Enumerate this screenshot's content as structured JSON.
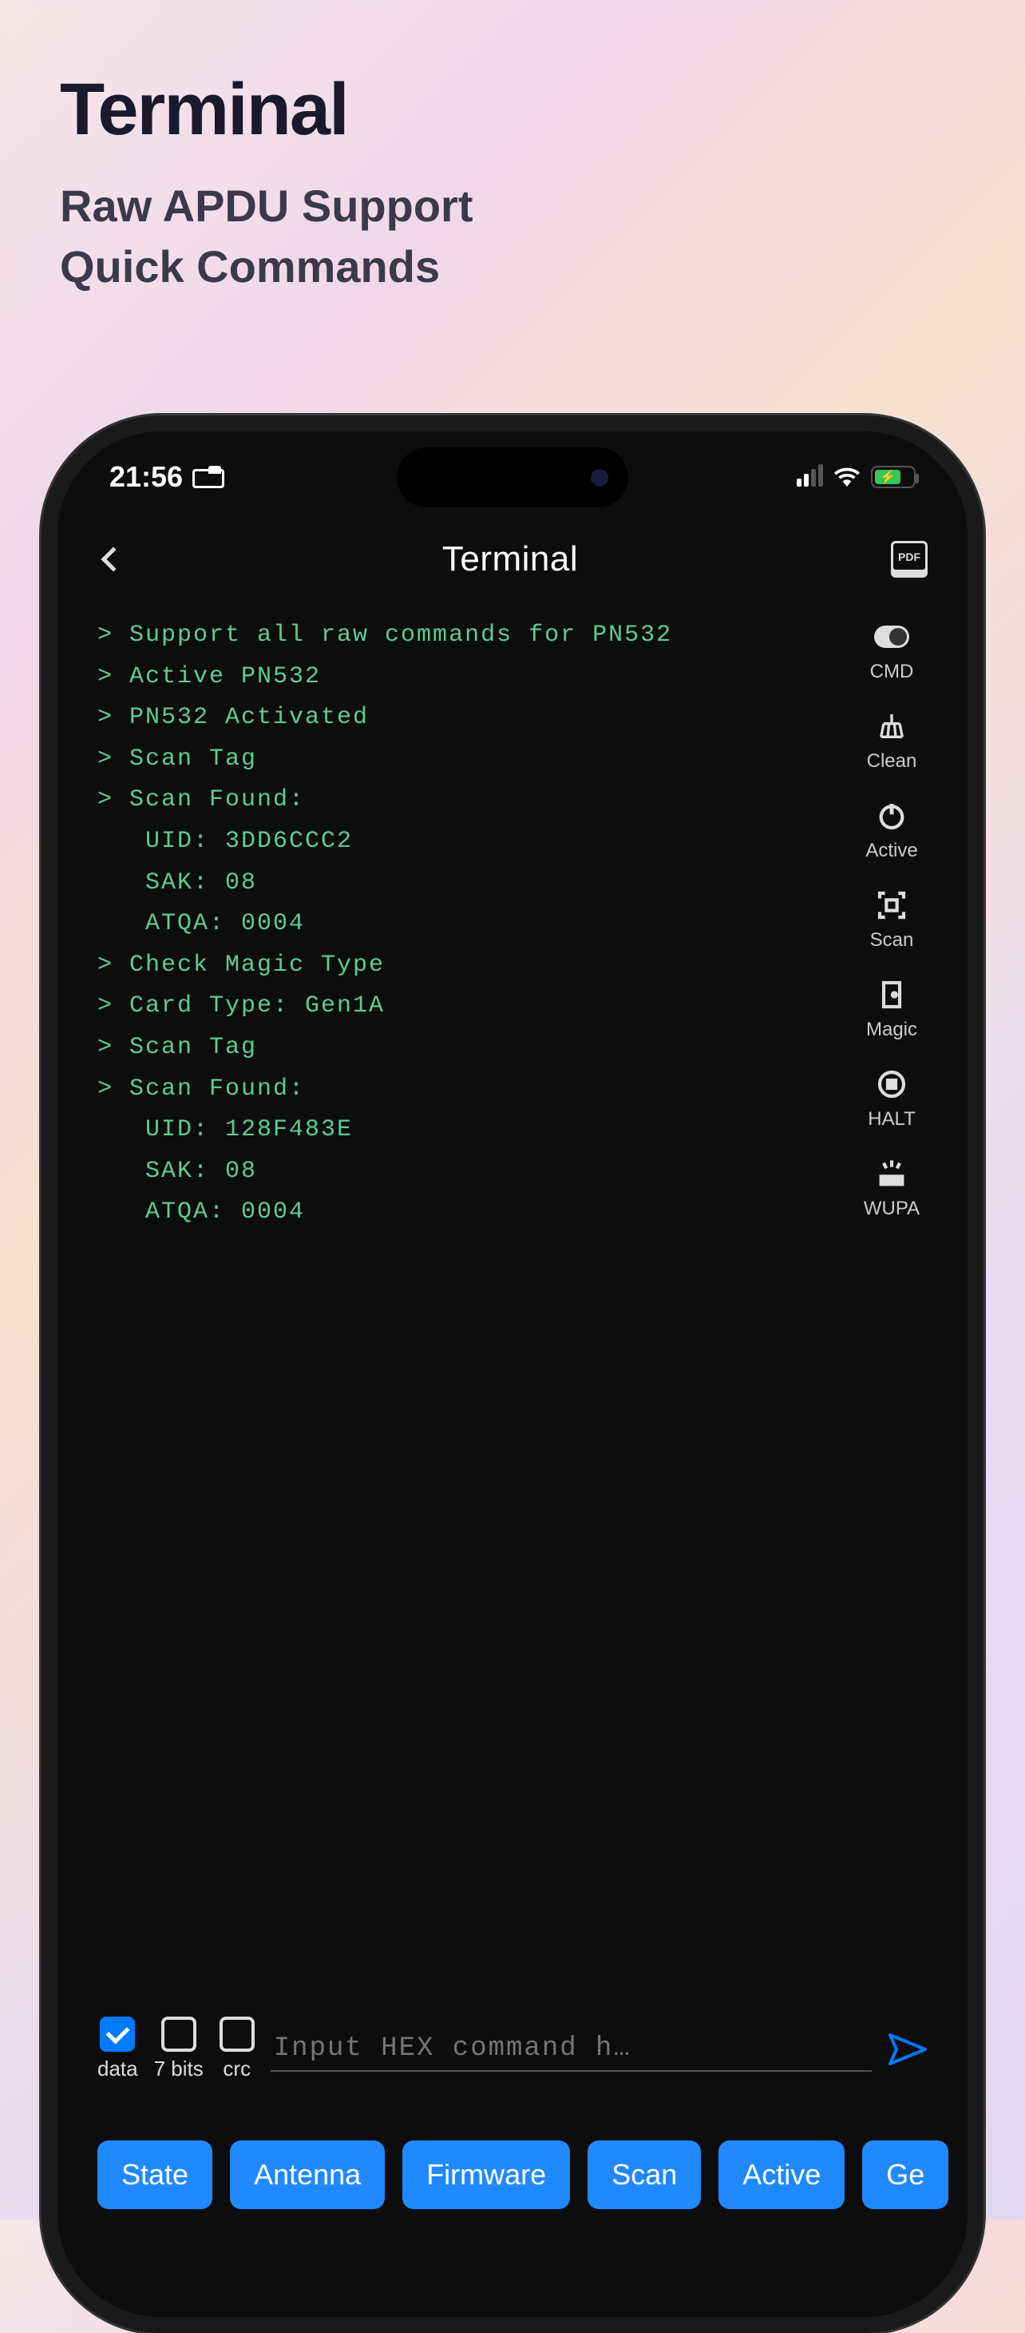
{
  "header": {
    "title": "Terminal",
    "subtitle_line1": "Raw APDU Support",
    "subtitle_line2": "Quick Commands"
  },
  "status": {
    "time": "21:56"
  },
  "nav": {
    "title": "Terminal"
  },
  "terminal_output": [
    "> Support all raw commands for PN532",
    "> Active PN532",
    "> PN532 Activated",
    "> Scan Tag",
    "> Scan Found:",
    "   UID: 3DD6CCC2",
    "   SAK: 08",
    "   ATQA: 0004",
    "> Check Magic Type",
    "> Card Type: Gen1A",
    "> Scan Tag",
    "> Scan Found:",
    "   UID: 128F483E",
    "   SAK: 08",
    "   ATQA: 0004"
  ],
  "side_tools": {
    "cmd": "CMD",
    "clean": "Clean",
    "active": "Active",
    "scan": "Scan",
    "magic": "Magic",
    "halt": "HALT",
    "wupa": "WUPA"
  },
  "checkboxes": {
    "data": {
      "label": "data",
      "checked": true
    },
    "bits7": {
      "label": "7 bits",
      "checked": false
    },
    "crc": {
      "label": "crc",
      "checked": false
    }
  },
  "input": {
    "placeholder": "Input HEX command h…"
  },
  "quick_commands": [
    "State",
    "Antenna",
    "Firmware",
    "Scan",
    "Active",
    "Ge"
  ]
}
